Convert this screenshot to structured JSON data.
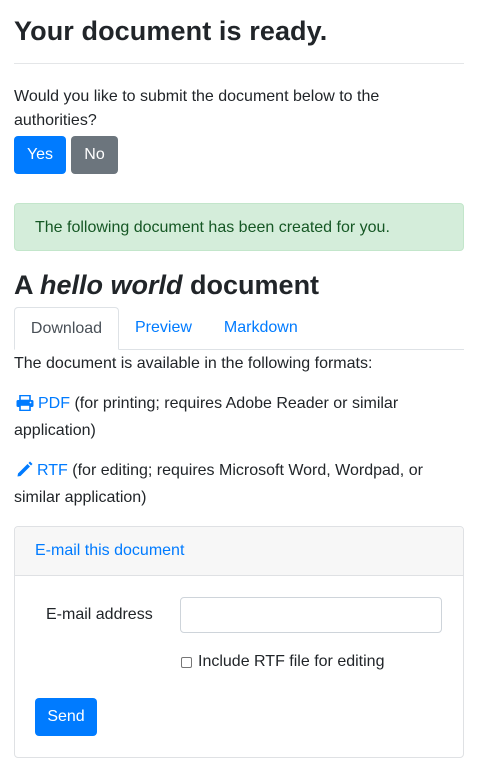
{
  "header": {
    "title": "Your document is ready."
  },
  "prompt": {
    "question": "Would you like to submit the document below to the authorities?",
    "yes_label": "Yes",
    "no_label": "No"
  },
  "alert": {
    "text": "The following document has been created for you."
  },
  "document": {
    "title_prefix": "A",
    "title_emphasis": "hello world",
    "title_suffix": "document"
  },
  "tabs": [
    {
      "label": "Download",
      "active": true
    },
    {
      "label": "Preview",
      "active": false
    },
    {
      "label": "Markdown",
      "active": false
    }
  ],
  "download": {
    "intro": "The document is available in the following formats:",
    "formats": [
      {
        "icon": "printer-icon",
        "link": "PDF",
        "note": "(for printing; requires Adobe Reader or similar application)"
      },
      {
        "icon": "pencil-icon",
        "link": "RTF",
        "note": "(for editing; requires Microsoft Word, Wordpad, or similar application)"
      }
    ]
  },
  "email_card": {
    "header": "E-mail this document",
    "email_label": "E-mail address",
    "email_value": "",
    "email_placeholder": "",
    "checkbox_label": "Include RTF file for editing",
    "checkbox_checked": false,
    "send_label": "Send"
  },
  "colors": {
    "primary": "#007bff",
    "secondary": "#6c757d",
    "success_bg": "#d4edda",
    "success_text": "#155724"
  }
}
